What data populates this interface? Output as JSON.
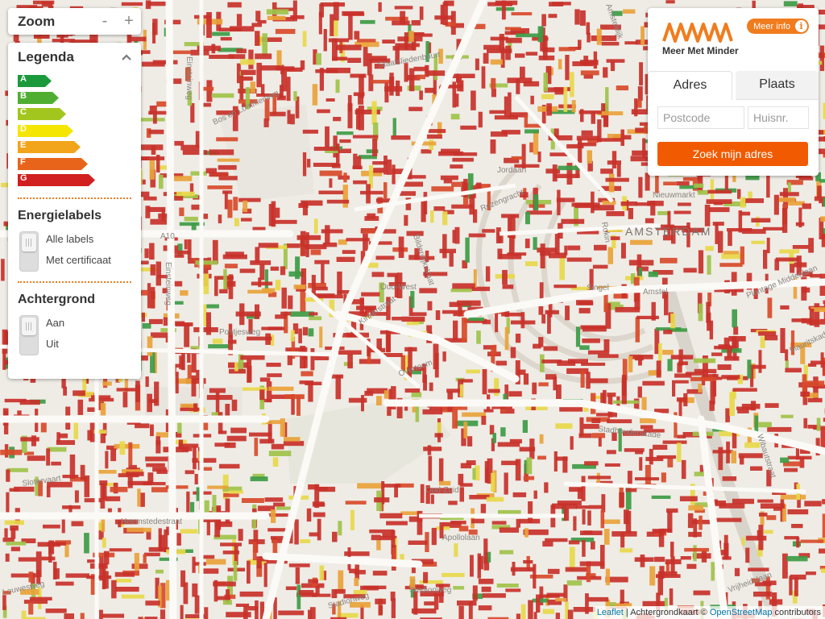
{
  "zoom": {
    "title": "Zoom",
    "minus": "-",
    "plus": "+"
  },
  "legend": {
    "title": "Legenda",
    "labels": [
      {
        "letter": "A",
        "color": "#1a9a3a"
      },
      {
        "letter": "B",
        "color": "#4fae32"
      },
      {
        "letter": "C",
        "color": "#a2c61e"
      },
      {
        "letter": "D",
        "color": "#f5e600"
      },
      {
        "letter": "E",
        "color": "#f2a41a"
      },
      {
        "letter": "F",
        "color": "#e8641a"
      },
      {
        "letter": "G",
        "color": "#d21f1f"
      }
    ],
    "energy_title": "Energielabels",
    "energy_options": [
      "Alle labels",
      "Met certificaat"
    ],
    "background_title": "Achtergrond",
    "background_options": [
      "Aan",
      "Uit"
    ]
  },
  "search": {
    "brand": "Meer Met Minder",
    "info_label": "Meer info",
    "tabs": [
      "Adres",
      "Plaats"
    ],
    "postcode_placeholder": "Postcode",
    "huisnr_placeholder": "Huisnr.",
    "button": "Zoek mijn adres"
  },
  "map": {
    "labels": {
      "amsterdam": "AMSTERDAM",
      "oud_west": "Oud-West",
      "oud_zuid": "Oud-Zuid",
      "jordaan": "Jordaan",
      "staatslieden": "Staatsliedenbuurt",
      "bos_lommerweg": "Bos en Lommerweg",
      "kinkerstraat": "Kinkerstraat",
      "overtoom": "Overtoom",
      "stadhouderskade": "Stadhouderskade",
      "slotervaart": "Slotervaart",
      "heemstedestraat": "Heemstedestraat",
      "apollolaan": "Apollolaan",
      "stadionweg": "Stadionweg",
      "postjesweg": "Postjesweg",
      "nieuwmarkt": "Nieuwmarkt",
      "singel": "Singel",
      "amstel": "Amstel",
      "a10": "A10",
      "einsteinweg": "Einsteinweg",
      "bilderdijkstraat": "Bilderdijkstraat",
      "rozengracht": "Rozengracht",
      "plantage": "Plantage Middenlaan",
      "wibautstraat": "Wibautstraat",
      "mauritskade": "Mauritskade",
      "vrijheidslaan": "Vrijheidslaan",
      "amsteldijk": "Amsteldijk",
      "rokin": "Rokin",
      "stadionweg2": "Stadionweg",
      "louwesweg": "Louwesweg"
    }
  },
  "attribution": {
    "leaflet": "Leaflet",
    "text1": " | Achtergrondkaart © ",
    "osm": "OpenStreetMap",
    "text2": " contributors"
  }
}
